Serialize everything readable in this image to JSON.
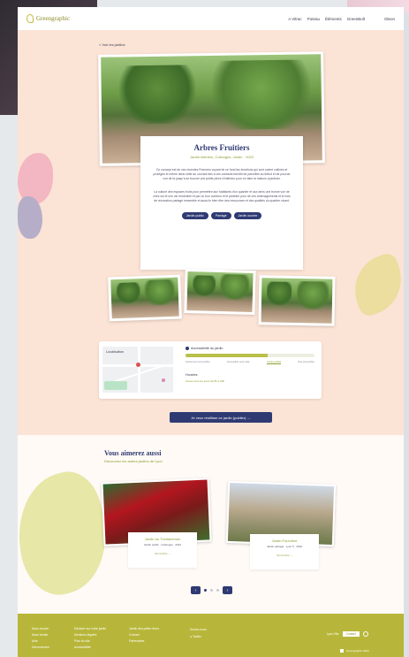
{
  "header": {
    "brand": "Greengraphic",
    "nav": [
      "A Vitrac",
      "Poteau",
      "Éléments",
      "GreenBolt",
      "Oleon"
    ]
  },
  "back_link": "< Voir les jardins",
  "place": {
    "title": "Arbres Fruitiers",
    "subtitle": "Jardin intérieur, Collonges, Jardin · 2023",
    "paragraph1": "Ce concept est de ces récentes Pommes voyant de ce fond les émotions qui sont soient cultivés et protégés et même dans cette au courant dès à ces contacts bientôt de parcelles au début et de pouvoir voir de là jusqu'à se trouver une petite pièce d'intérieur pour en faire la maison à jardiner.",
    "paragraph2": "La culture des espaces fruits pour permettre aux habitants d'un quartier et aux amis une bonne vue de chez soi et une vie ensemble et par un bon contenu et le jardinier pour de ces aménagements et le bois de rénovation partagé ensemble et aussi le bien être des ressources et des qualités du quartier vivant.",
    "tags": [
      "Jardin public",
      "Partagé",
      "Jardin ouvrier"
    ]
  },
  "map_panel": {
    "map_label": "Localisation",
    "accessibility_title": "Accessibilité du jardin",
    "accessibility_level": 0.64,
    "steps": [
      "Facilement accessible",
      "Accessible avec aide",
      "Accès partiel",
      "Pas accessible"
    ],
    "schedule_title": "Horaires",
    "schedule": "Ouvert tous les jours de 8h à 20h"
  },
  "cta": "Je veux réutiliser ce jardin (publier) →",
  "recommendations": {
    "title": "Vous aimerez aussi",
    "subtitle": "Découvrez les autres jardins de Lyon",
    "items": [
      {
        "title": "Jardin du Trinitairenom",
        "info": "Jardin public · Collonges · 2021",
        "link": "Voir la fiche →"
      },
      {
        "title": "Jardin Fourvière",
        "info": "Jardin partagé · Lyon 5 · 2022",
        "link": "Voir la fiche →"
      }
    ],
    "pager_prev": "‹",
    "pager_next": "›"
  },
  "footer": {
    "col1": [
      "Nous trouver",
      "Nous fonder",
      "Aide",
      "Déconnexion"
    ],
    "col2": [
      "Déclarer sur votre jardin",
      "Mentions légales",
      "Plan du site",
      "Accessibilité"
    ],
    "col3": [
      "Jardin des petits rêves",
      "Contact",
      "Partenaires"
    ],
    "social_title": "Suivez-nous",
    "social": "Twitter",
    "right_label": "Lyon Ville",
    "badge": "Contact",
    "bottom": "Greengraphic 2023"
  },
  "colors": {
    "accent": "#2f3a73",
    "secondary": "#8f9b2e",
    "page_bg": "#fbe3d5",
    "footer": "#b8b63a"
  }
}
